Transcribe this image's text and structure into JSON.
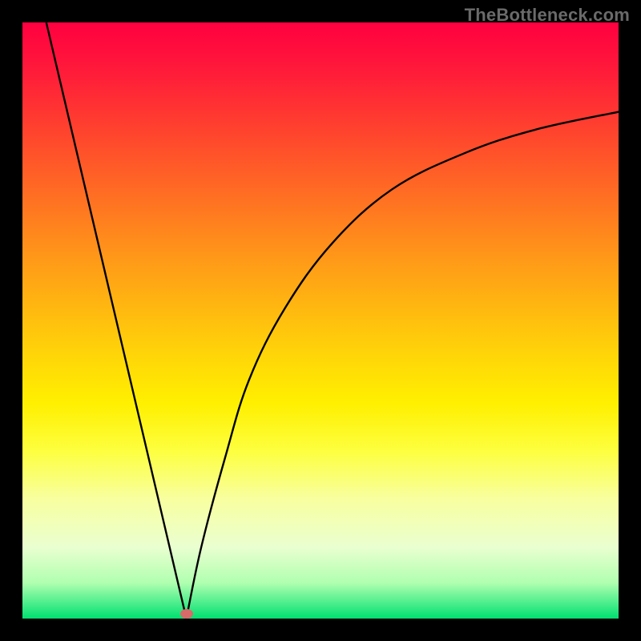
{
  "watermark": "TheBottleneck.com",
  "chart_data": {
    "type": "line",
    "title": "",
    "xlabel": "",
    "ylabel": "",
    "xlim": [
      0,
      100
    ],
    "ylim": [
      0,
      100
    ],
    "grid": false,
    "background": "vertical gradient red→orange→yellow→green",
    "series": [
      {
        "name": "left-branch",
        "x": [
          4,
          8,
          12,
          16,
          20,
          24,
          27.5
        ],
        "y": [
          100,
          84,
          67,
          50,
          33,
          16,
          0
        ]
      },
      {
        "name": "right-branch",
        "x": [
          27.5,
          30,
          34,
          38,
          44,
          52,
          62,
          74,
          86,
          100
        ],
        "y": [
          0,
          12,
          27,
          40,
          52,
          63,
          72,
          78,
          82,
          85
        ]
      }
    ],
    "marker": {
      "x": 27.5,
      "y": 0.8,
      "color": "#d96a6a"
    }
  }
}
